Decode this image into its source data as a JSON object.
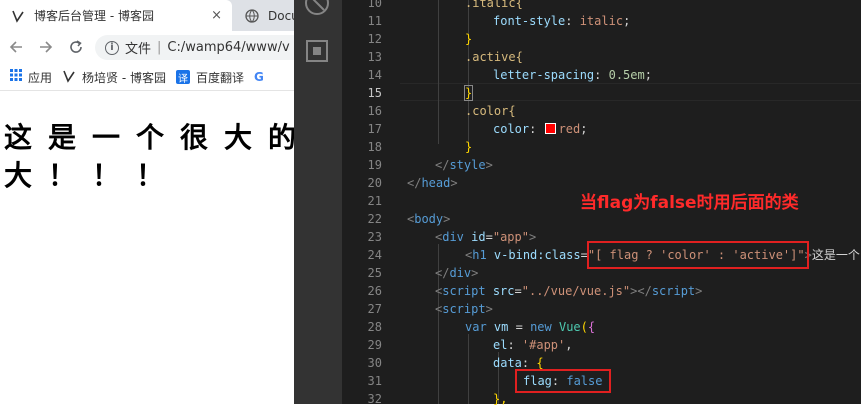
{
  "browser": {
    "tabs": [
      {
        "title": "博客后台管理 - 博客园",
        "close": "×"
      },
      {
        "title": "Docu"
      }
    ],
    "address_scheme_label": "文件",
    "address_separator": "|",
    "address_url": "C:/wamp64/www/v",
    "bookmarks": [
      {
        "label": "应用",
        "icon": "apps-icon"
      },
      {
        "label": "杨培贤 - 博客园",
        "icon": "cnblogs-icon"
      },
      {
        "label": "百度翻译",
        "icon": "translate-icon",
        "glyph": "译"
      },
      {
        "label": "G",
        "icon": "google-icon"
      }
    ],
    "page_lines": [
      "这是一个很大的",
      "大！！！"
    ]
  },
  "editor": {
    "current_line": "15",
    "line_numbers": [
      "10",
      "11",
      "12",
      "13",
      "14",
      "15",
      "16",
      "17",
      "18",
      "19",
      "20",
      "21",
      "22",
      "23",
      "24",
      "25",
      "26",
      "27",
      "28",
      "29",
      "30",
      "31",
      "32"
    ],
    "annotation": "当flag为false时用后面的类",
    "lines": {
      "l10": ".italic{",
      "l11_prop": "font-style",
      "l11_val": "italic",
      "l12": "}",
      "l13": ".active{",
      "l14_prop": "letter-spacing",
      "l14_val": "0.5em",
      "l15": "}",
      "l16": ".color{",
      "l17_prop": "color",
      "l17_val": "red",
      "l18": "}",
      "l19_tag": "style",
      "l20_tag": "head",
      "l22_tag": "body",
      "l23_tag": "div",
      "l23_attr": "id",
      "l23_val": "\"app\"",
      "l24_tag": "h1",
      "l24_attr": "v-bind:class",
      "l24_val": "\"[ flag ? 'color' : 'active']\"",
      "l24_text": "这是一个",
      "l25_tag": "div",
      "l26_tag": "script",
      "l26_attr": "src",
      "l26_val": "\"../vue/vue.js\"",
      "l27_tag": "script",
      "l28_kw": "var",
      "l28_var": "vm",
      "l28_new": "new",
      "l28_cls": "Vue",
      "l29_key": "el",
      "l29_val": "'#app'",
      "l30_key": "data",
      "l31_key": "flag",
      "l31_val": "false",
      "l32": "},"
    }
  },
  "colors": {
    "annotation": "#ff2a2a",
    "redbox": "#e02020",
    "editor_bg": "#1e1e1e",
    "activity_bar": "#333333"
  }
}
